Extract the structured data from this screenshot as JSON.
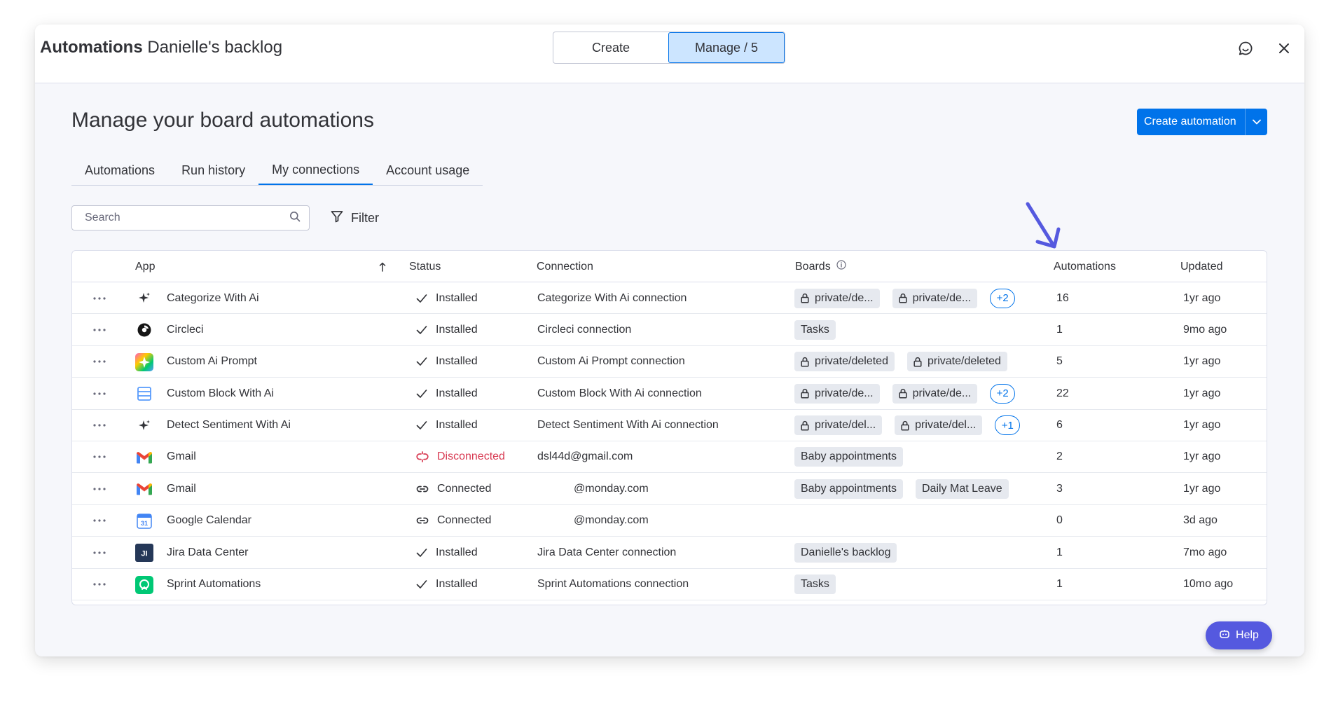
{
  "window": {
    "title_strong": "Automations",
    "title_sub": "Danielle's backlog"
  },
  "toggle": {
    "create_label": "Create",
    "manage_label": "Manage / 5",
    "selected": "manage"
  },
  "header": {
    "page_title": "Manage your board automations",
    "create_button_label": "Create automation"
  },
  "tabs": [
    {
      "label": "Automations",
      "active": false
    },
    {
      "label": "Run history",
      "active": false
    },
    {
      "label": "My connections",
      "active": true
    },
    {
      "label": "Account usage",
      "active": false
    }
  ],
  "search": {
    "placeholder": "Search",
    "value": ""
  },
  "filter": {
    "label": "Filter"
  },
  "table": {
    "columns": {
      "app": "App",
      "status": "Status",
      "connection": "Connection",
      "boards": "Boards",
      "automations": "Automations",
      "updated": "Updated"
    },
    "sort": {
      "column": "app",
      "direction": "ascending"
    },
    "rows": [
      {
        "app": "Categorize With Ai",
        "icon": "sparkle-icon",
        "status": "Installed",
        "status_type": "installed",
        "connection": "Categorize With Ai connection",
        "boards": [
          {
            "label": "private/de...",
            "locked": true
          },
          {
            "label": "private/de...",
            "locked": true
          }
        ],
        "more": "+2",
        "automations": "16",
        "updated": "1yr ago"
      },
      {
        "app": "Circleci",
        "icon": "circleci-icon",
        "status": "Installed",
        "status_type": "installed",
        "connection": "Circleci connection",
        "boards": [
          {
            "label": "Tasks",
            "locked": false
          }
        ],
        "more": "",
        "automations": "1",
        "updated": "9mo ago"
      },
      {
        "app": "Custom Ai Prompt",
        "icon": "ai-prompt-icon",
        "status": "Installed",
        "status_type": "installed",
        "connection": "Custom Ai Prompt connection",
        "boards": [
          {
            "label": "private/deleted",
            "locked": true
          },
          {
            "label": "private/deleted",
            "locked": true
          }
        ],
        "more": "",
        "automations": "5",
        "updated": "1yr ago"
      },
      {
        "app": "Custom Block With Ai",
        "icon": "custom-block-icon",
        "status": "Installed",
        "status_type": "installed",
        "connection": "Custom Block With Ai connection",
        "boards": [
          {
            "label": "private/de...",
            "locked": true
          },
          {
            "label": "private/de...",
            "locked": true
          }
        ],
        "more": "+2",
        "automations": "22",
        "updated": "1yr ago"
      },
      {
        "app": "Detect Sentiment With Ai",
        "icon": "sparkle-icon",
        "status": "Installed",
        "status_type": "installed",
        "connection": "Detect Sentiment With Ai connection",
        "boards": [
          {
            "label": "private/del...",
            "locked": true
          },
          {
            "label": "private/del...",
            "locked": true
          }
        ],
        "more": "+1",
        "automations": "6",
        "updated": "1yr ago"
      },
      {
        "app": "Gmail",
        "icon": "gmail-icon",
        "status": "Disconnected",
        "status_type": "disconnected",
        "connection": "dsl44d@gmail.com",
        "boards": [
          {
            "label": "Baby appointments",
            "locked": false
          }
        ],
        "more": "",
        "automations": "2",
        "updated": "1yr ago"
      },
      {
        "app": "Gmail",
        "icon": "gmail-icon",
        "status": "Connected",
        "status_type": "connected",
        "connection": "@monday.com",
        "boards": [
          {
            "label": "Baby appointments",
            "locked": false
          },
          {
            "label": "Daily Mat Leave",
            "locked": false
          }
        ],
        "more": "",
        "automations": "3",
        "updated": "1yr ago"
      },
      {
        "app": "Google Calendar",
        "icon": "google-calendar-icon",
        "status": "Connected",
        "status_type": "connected",
        "connection": "@monday.com",
        "boards": [],
        "more": "",
        "automations": "0",
        "updated": "3d ago"
      },
      {
        "app": "Jira Data Center",
        "icon": "jira-icon",
        "status": "Installed",
        "status_type": "installed",
        "connection": "Jira Data Center connection",
        "boards": [
          {
            "label": "Danielle's backlog",
            "locked": false
          }
        ],
        "more": "",
        "automations": "1",
        "updated": "7mo ago"
      },
      {
        "app": "Sprint Automations",
        "icon": "sprint-automations-icon",
        "status": "Installed",
        "status_type": "installed",
        "connection": "Sprint Automations connection",
        "boards": [
          {
            "label": "Tasks",
            "locked": false
          }
        ],
        "more": "",
        "automations": "1",
        "updated": "10mo ago"
      }
    ]
  },
  "help": {
    "label": "Help"
  },
  "colors": {
    "primary": "#0073ea",
    "danger": "#d83a52",
    "help": "#5559df",
    "annotation_arrow": "#5559df"
  }
}
